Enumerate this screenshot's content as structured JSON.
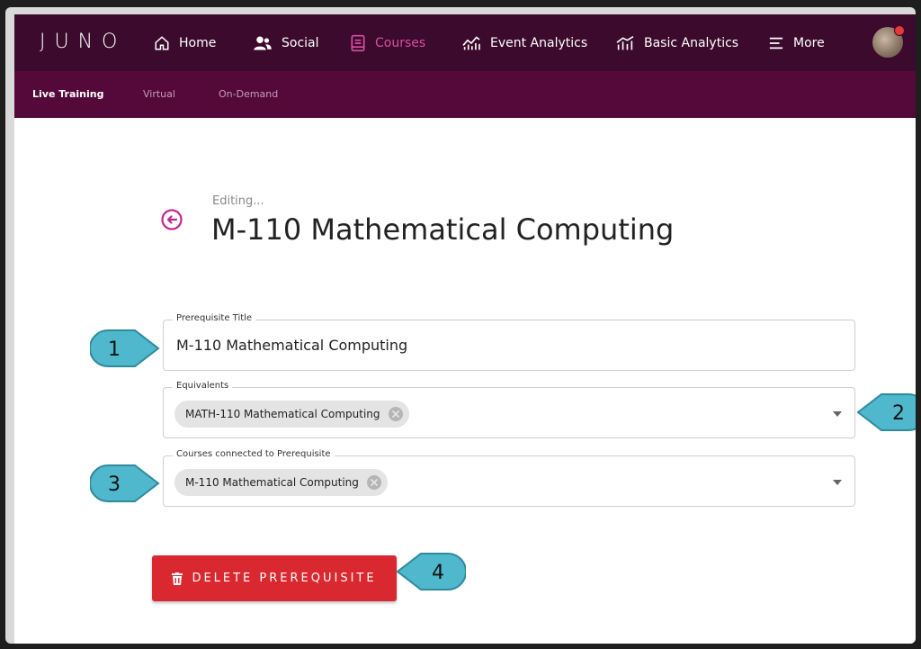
{
  "brand": {
    "logo": "JUNO"
  },
  "nav": {
    "items": [
      {
        "label": "Home",
        "icon": "home-icon"
      },
      {
        "label": "Social",
        "icon": "people-icon"
      },
      {
        "label": "Courses",
        "icon": "book-icon",
        "active": true
      },
      {
        "label": "Event Analytics",
        "icon": "area-chart-icon"
      },
      {
        "label": "Basic Analytics",
        "icon": "bar-chart-icon"
      },
      {
        "label": "More",
        "icon": "menu-lines-icon"
      }
    ],
    "active_color": "#d84fa6"
  },
  "subnav": {
    "items": [
      {
        "label": "Live Training",
        "active": true
      },
      {
        "label": "Virtual"
      },
      {
        "label": "On-Demand"
      }
    ]
  },
  "editor": {
    "status": "Editing...",
    "title": "M-110 Mathematical Computing"
  },
  "form": {
    "prerequisite_title": {
      "label": "Prerequisite Title",
      "value": "M-110 Mathematical Computing"
    },
    "equivalents": {
      "label": "Equivalents",
      "chips": [
        "MATH-110 Mathematical Computing"
      ]
    },
    "connected_courses": {
      "label": "Courses connected to Prerequisite",
      "chips": [
        "M-110 Mathematical Computing"
      ]
    }
  },
  "actions": {
    "delete_label": "DELETE PREREQUISITE"
  },
  "callouts": [
    "1",
    "2",
    "3",
    "4"
  ],
  "colors": {
    "topnav_bg": "#3c0a2c",
    "subnav_bg": "#55093b",
    "delete_bg": "#d9282f",
    "callout_fill": "#4fb8cc",
    "accent": "#c2288f"
  }
}
